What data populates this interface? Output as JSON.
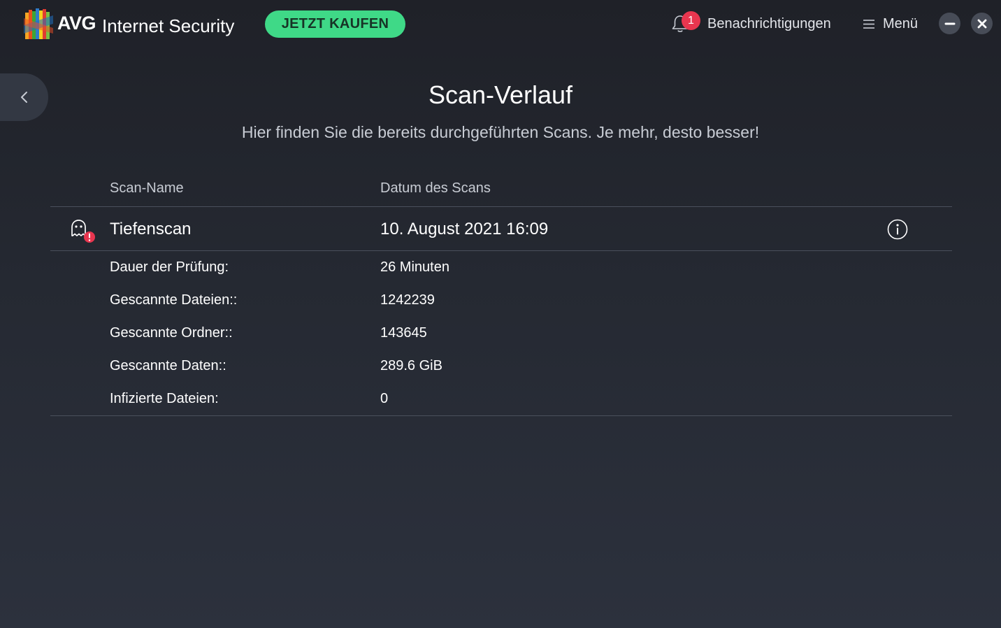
{
  "header": {
    "brand": "AVG",
    "product": "Internet Security",
    "buy_button": "JETZT KAUFEN",
    "notifications": {
      "label": "Benachrichtigungen",
      "count": "1"
    },
    "menu_label": "Menü"
  },
  "page": {
    "title": "Scan-Verlauf",
    "subtitle": "Hier finden Sie die bereits durchgeführten Scans. Je mehr, desto besser!"
  },
  "table": {
    "columns": {
      "name": "Scan-Name",
      "date": "Datum des Scans"
    },
    "scan": {
      "name": "Tiefenscan",
      "date": "10. August 2021 16:09"
    },
    "details": [
      {
        "label": "Dauer der Prüfung:",
        "value": "26 Minuten"
      },
      {
        "label": "Gescannte Dateien::",
        "value": "1242239"
      },
      {
        "label": "Gescannte Ordner::",
        "value": "143645"
      },
      {
        "label": "Gescannte Daten::",
        "value": "289.6 GiB"
      },
      {
        "label": "Infizierte Dateien:",
        "value": "0"
      }
    ]
  },
  "icons": {
    "logo": "avg-logo-icon",
    "notifications": "bell-icon",
    "menu": "hamburger-icon",
    "minimize": "minimize-icon",
    "close": "close-icon",
    "back": "chevron-left-icon",
    "scan_type": "ghost-alert-icon",
    "info": "info-icon"
  },
  "colors": {
    "accent_green": "#3fd987",
    "alert_red": "#e8364f",
    "background": "#252932"
  }
}
